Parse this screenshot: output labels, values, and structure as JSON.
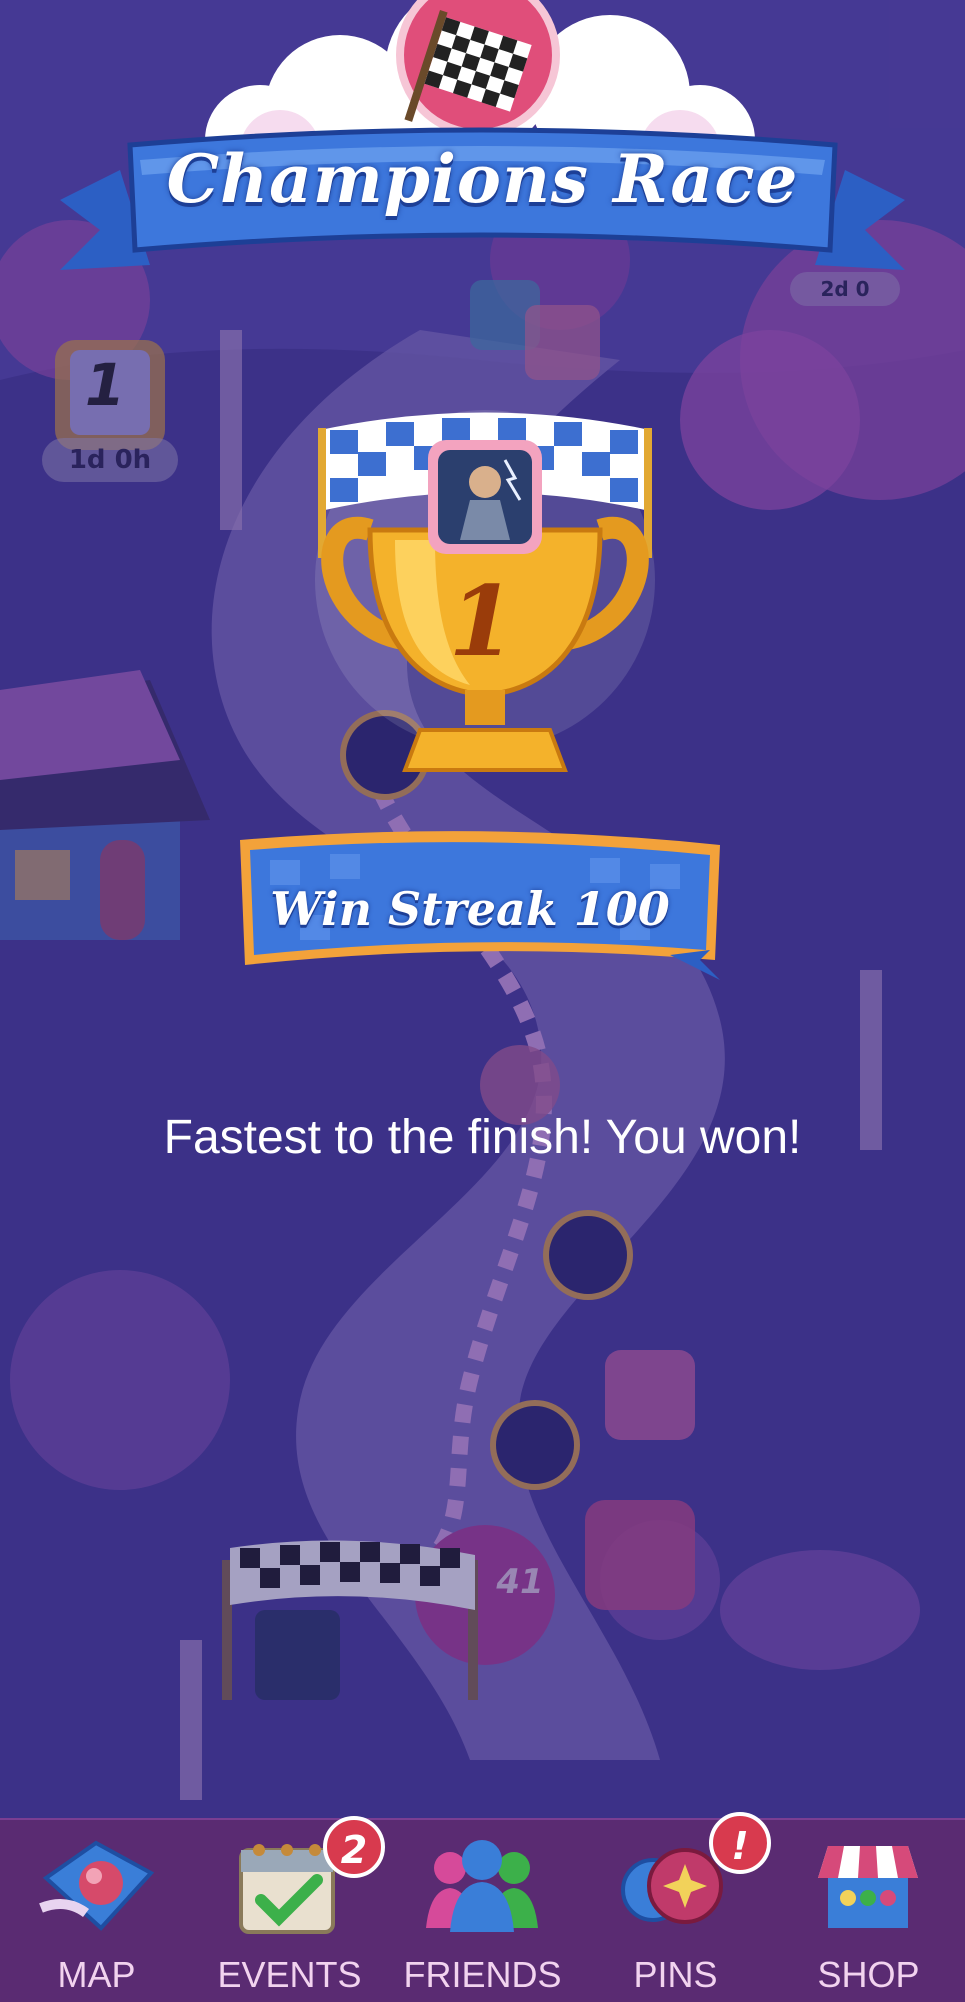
{
  "header": {
    "title": "Champions Race"
  },
  "trophy": {
    "rank": "1"
  },
  "streak": {
    "label": "Win Streak 100"
  },
  "result": {
    "message": "Fastest to the finish! You won!"
  },
  "background": {
    "event_timer": "1d 0h",
    "event_rank": "1",
    "right_timer": "2d 0",
    "current_level": "41"
  },
  "nav": {
    "items": [
      {
        "label": "MAP",
        "icon": "map-icon",
        "badge": ""
      },
      {
        "label": "EVENTS",
        "icon": "events-calendar-icon",
        "badge": "2"
      },
      {
        "label": "FRIENDS",
        "icon": "friends-icon",
        "badge": ""
      },
      {
        "label": "PINS",
        "icon": "pins-icon",
        "badge": "!"
      },
      {
        "label": "SHOP",
        "icon": "shop-icon",
        "badge": ""
      }
    ]
  },
  "colors": {
    "ribbon": "#3d77dc",
    "ribbon_dark": "#1d3f96",
    "trophy_gold": "#f4b22b",
    "badge_red": "#d83a4e",
    "nav_bg": "#5a2b72",
    "overlay": "#281e6e"
  }
}
